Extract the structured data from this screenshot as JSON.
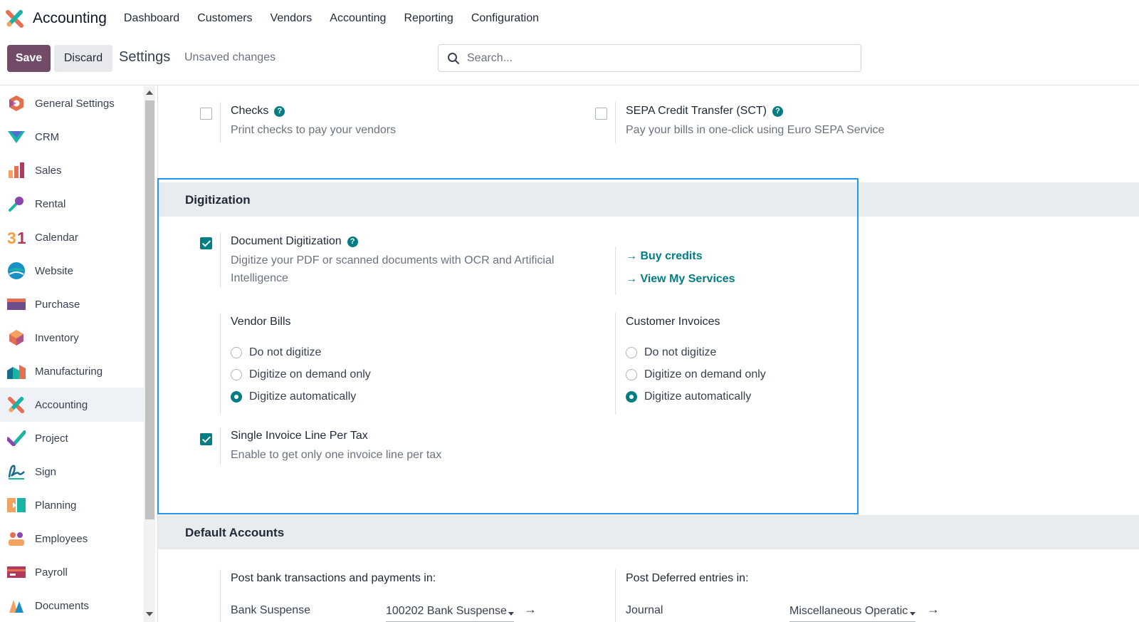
{
  "app": {
    "name": "Accounting"
  },
  "menu": [
    "Dashboard",
    "Customers",
    "Vendors",
    "Accounting",
    "Reporting",
    "Configuration"
  ],
  "control": {
    "save": "Save",
    "discard": "Discard",
    "title": "Settings",
    "unsaved": "Unsaved changes",
    "search_placeholder": "Search..."
  },
  "sidebar": {
    "items": [
      {
        "label": "General Settings",
        "icon": "general-settings-icon",
        "color": "#e46f4e"
      },
      {
        "label": "CRM",
        "icon": "crm-icon",
        "color": "#1ab4a7"
      },
      {
        "label": "Sales",
        "icon": "sales-icon",
        "color": "#f4a261"
      },
      {
        "label": "Rental",
        "icon": "rental-key-icon",
        "color": "#8e44ad"
      },
      {
        "label": "Calendar",
        "icon": "calendar-icon",
        "color": "#f0a03c"
      },
      {
        "label": "Website",
        "icon": "website-icon",
        "color": "#1a90c4"
      },
      {
        "label": "Purchase",
        "icon": "purchase-icon",
        "color": "#6b4e8a"
      },
      {
        "label": "Inventory",
        "icon": "inventory-icon",
        "color": "#e76f51"
      },
      {
        "label": "Manufacturing",
        "icon": "manufacturing-icon",
        "color": "#1ab4a7"
      },
      {
        "label": "Accounting",
        "icon": "accounting-icon",
        "color": "#e76f51"
      },
      {
        "label": "Project",
        "icon": "project-icon",
        "color": "#1ab4a7"
      },
      {
        "label": "Sign",
        "icon": "sign-icon",
        "color": "#1a6d8a"
      },
      {
        "label": "Planning",
        "icon": "planning-icon",
        "color": "#f4a261"
      },
      {
        "label": "Employees",
        "icon": "employees-icon",
        "color": "#e76f51"
      },
      {
        "label": "Payroll",
        "icon": "payroll-icon",
        "color": "#b03a5b"
      },
      {
        "label": "Documents",
        "icon": "documents-icon",
        "color": "#f4a261"
      }
    ],
    "active": "Accounting"
  },
  "payments": {
    "checks": {
      "title": "Checks",
      "desc": "Print checks to pay your vendors"
    },
    "sepa": {
      "title": "SEPA Credit Transfer (SCT)",
      "desc": "Pay your bills in one-click using Euro SEPA Service"
    }
  },
  "digitization": {
    "heading": "Digitization",
    "doc": {
      "title": "Document Digitization",
      "desc": "Digitize your PDF or scanned documents with OCR and Artificial Intelligence",
      "checked": true
    },
    "links": {
      "buy": "Buy credits",
      "services": "View My Services"
    },
    "vendor": {
      "title": "Vendor Bills",
      "options": [
        "Do not digitize",
        "Digitize on demand only",
        "Digitize automatically"
      ],
      "selected": 2
    },
    "customer": {
      "title": "Customer Invoices",
      "options": [
        "Do not digitize",
        "Digitize on demand only",
        "Digitize automatically"
      ],
      "selected": 2
    },
    "single": {
      "title": "Single Invoice Line Per Tax",
      "desc": "Enable to get only one invoice line per tax",
      "checked": true
    }
  },
  "default_accounts": {
    "heading": "Default Accounts",
    "bank": {
      "title": "Post bank transactions and payments in:",
      "label": "Bank Suspense",
      "value": "100202 Bank Suspense"
    },
    "deferred": {
      "title": "Post Deferred entries in:",
      "label": "Journal",
      "value": "Miscellaneous Operatic"
    }
  },
  "colors": {
    "brand": "#714b67",
    "accent": "#017e84",
    "highlight": "#2196f3"
  }
}
